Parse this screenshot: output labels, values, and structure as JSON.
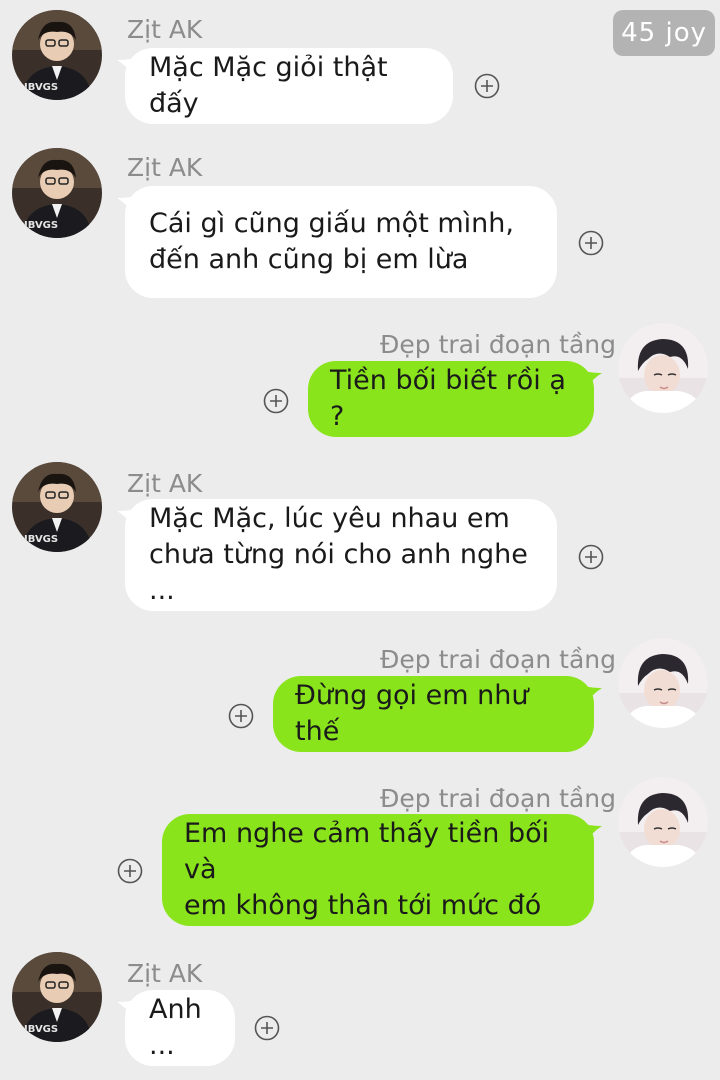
{
  "watermark": "45 joy",
  "colors": {
    "background": "#ececec",
    "incoming_bubble": "#ffffff",
    "outgoing_bubble": "#8ae41c",
    "name_text": "#8c8c8c"
  },
  "messages": [
    {
      "sender": "Zịt AK",
      "direction": "in",
      "text": "Mặc Mặc giỏi thật đấy"
    },
    {
      "sender": "Zịt AK",
      "direction": "in",
      "text": "Cái gì cũng giấu một mình,\nđến anh cũng bị em lừa"
    },
    {
      "sender": "Đẹp trai đoạn tầng",
      "direction": "out",
      "text": "Tiền bối biết rồi ạ ?"
    },
    {
      "sender": "Zịt AK",
      "direction": "in",
      "text": "Mặc Mặc, lúc yêu nhau em\nchưa từng nói cho anh nghe ..."
    },
    {
      "sender": "Đẹp trai đoạn tầng",
      "direction": "out",
      "text": "Đừng gọi em như thế"
    },
    {
      "sender": "Đẹp trai đoạn tầng",
      "direction": "out",
      "text": "Em nghe cảm thấy tiền bối và\nem không thân tới mức đó"
    },
    {
      "sender": "Zịt AK",
      "direction": "in",
      "text": "Anh ..."
    }
  ]
}
